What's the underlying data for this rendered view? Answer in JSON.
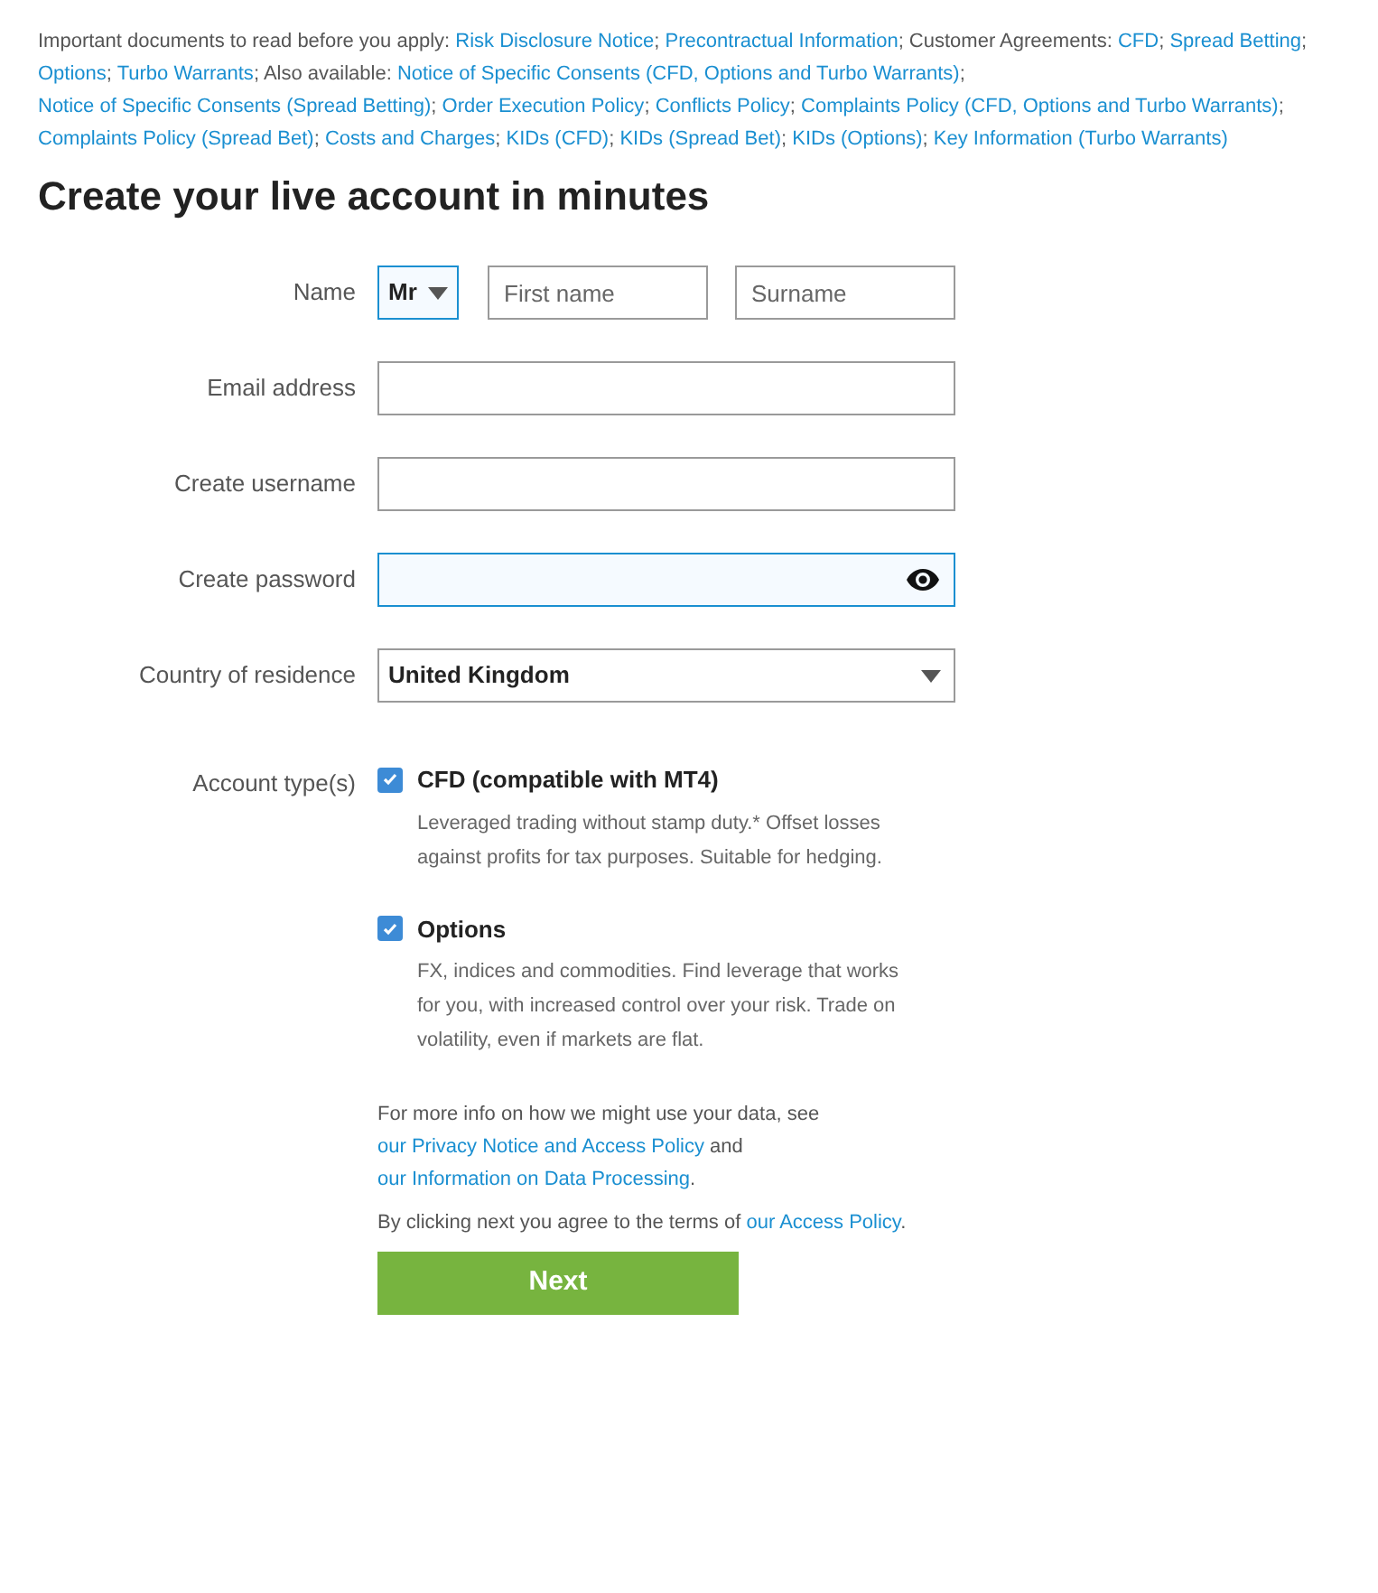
{
  "notice": [
    {
      "text": "Important documents to read before you apply: ",
      "link": false
    },
    {
      "text": "Risk Disclosure Notice",
      "link": true
    },
    {
      "text": "; ",
      "link": false
    },
    {
      "text": "Precontractual Information",
      "link": true
    },
    {
      "text": "; Customer Agreements: ",
      "link": false
    },
    {
      "text": "CFD",
      "link": true
    },
    {
      "text": "; ",
      "link": false
    },
    {
      "text": "Spread Betting",
      "link": true
    },
    {
      "text": "; ",
      "link": false
    },
    {
      "text": "Options",
      "link": true
    },
    {
      "text": "; ",
      "link": false
    },
    {
      "text": "Turbo Warrants",
      "link": true
    },
    {
      "text": "; Also available: ",
      "link": false
    },
    {
      "text": "Notice of Specific Consents (CFD, Options and Turbo Warrants)",
      "link": true
    },
    {
      "text": "; ",
      "link": false
    },
    {
      "text": "Notice of Specific Consents (Spread Betting)",
      "link": true
    },
    {
      "text": "; ",
      "link": false
    },
    {
      "text": "Order Execution Policy",
      "link": true
    },
    {
      "text": "; ",
      "link": false
    },
    {
      "text": "Conflicts Policy",
      "link": true
    },
    {
      "text": "; ",
      "link": false
    },
    {
      "text": "Complaints Policy (CFD, Options and Turbo Warrants)",
      "link": true
    },
    {
      "text": "; ",
      "link": false
    },
    {
      "text": "Complaints Policy (Spread Bet)",
      "link": true
    },
    {
      "text": "; ",
      "link": false
    },
    {
      "text": "Costs and Charges",
      "link": true
    },
    {
      "text": "; ",
      "link": false
    },
    {
      "text": "KIDs (CFD)",
      "link": true
    },
    {
      "text": "; ",
      "link": false
    },
    {
      "text": "KIDs (Spread Bet)",
      "link": true
    },
    {
      "text": "; ",
      "link": false
    },
    {
      "text": "KIDs (Options)",
      "link": true
    },
    {
      "text": "; ",
      "link": false
    },
    {
      "text": "Key Information (Turbo Warrants)",
      "link": true
    }
  ],
  "title": "Create your live account in minutes",
  "name_row": {
    "label": "Name",
    "title_select": {
      "value": "Mr",
      "focused": true
    },
    "first_name": {
      "placeholder": "First name",
      "focused": false
    },
    "surname": {
      "placeholder": "Surname",
      "focused": false
    }
  },
  "fields": [
    {
      "label": "Email address",
      "kind": "text",
      "focused": false
    },
    {
      "label": "Create username",
      "kind": "text",
      "focused": false
    },
    {
      "label": "Create password",
      "kind": "password",
      "focused": true
    },
    {
      "label": "Country of residence",
      "kind": "select",
      "value": "United Kingdom",
      "focused": false
    }
  ],
  "account_types": {
    "label": "Account type(s)",
    "options": [
      {
        "label": "CFD (compatible with MT4)",
        "description": "Leveraged trading without stamp duty.* Offset losses against profits for tax purposes. Suitable for hedging.",
        "checked": true
      },
      {
        "label": "Options",
        "description": "FX, indices and commodities. Find leverage that works for you, with increased control over your risk. Trade on volatility, even if markets are flat.",
        "checked": true
      }
    ]
  },
  "privacy": [
    {
      "text": "For more info on how we might use your data, see ",
      "link": false
    },
    {
      "text": "our Privacy Notice and Access Policy",
      "link": true
    },
    {
      "text": " and ",
      "link": false
    },
    {
      "text": "our Information on Data Processing",
      "link": true
    },
    {
      "text": ".",
      "link": false
    }
  ],
  "agreement": [
    {
      "text": "By clicking next you agree to the terms of ",
      "link": false
    },
    {
      "text": "our Access Policy",
      "link": true
    },
    {
      "text": ".",
      "link": false
    }
  ],
  "next_button": "Next"
}
